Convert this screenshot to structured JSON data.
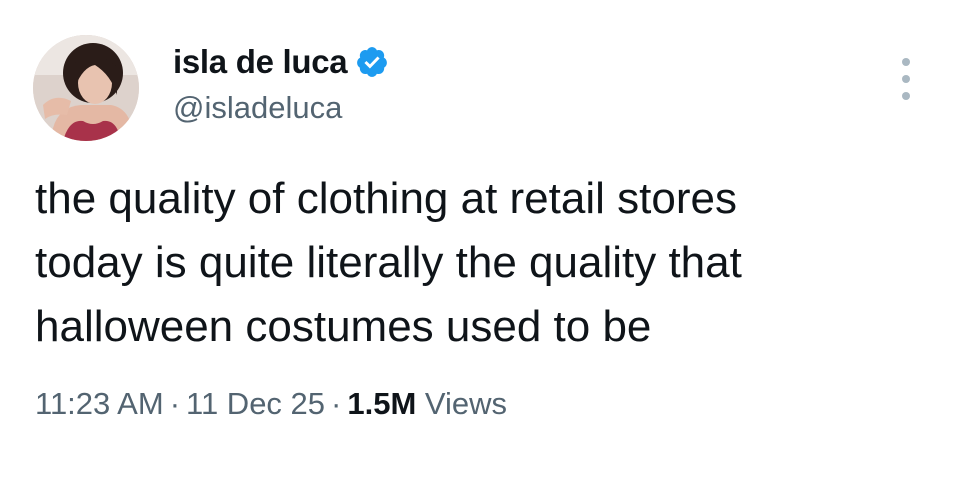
{
  "author": {
    "display_name": "isla de luca",
    "handle": "@isladeluca",
    "verified": true,
    "verified_color": "#1d9bf0"
  },
  "menu": {
    "icon": "more-vertical-icon"
  },
  "tweet": {
    "text_lines": [
      "the quality of clothing at retail stores",
      "today is quite literally the quality that",
      "halloween costumes used to be"
    ]
  },
  "meta": {
    "time": "11:23 AM",
    "separator": "·",
    "date": "11 Dec 25",
    "views_count": "1.5M",
    "views_label": "Views"
  },
  "colors": {
    "text_primary": "#0f1419",
    "text_secondary": "#536471",
    "background": "#ffffff"
  }
}
